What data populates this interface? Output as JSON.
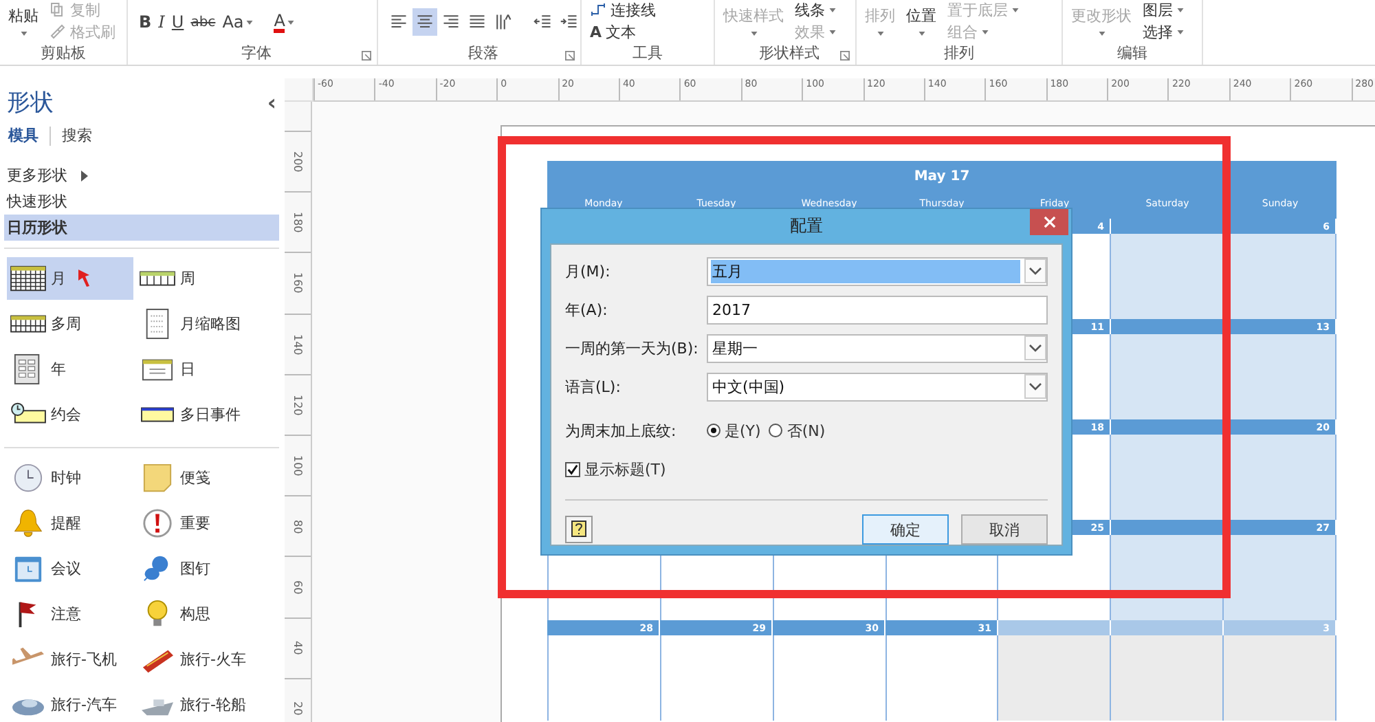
{
  "ribbon": {
    "groups": [
      {
        "label": "剪贴板",
        "launcher": false,
        "stacks": [
          [
            {
              "kind": "large",
              "label": "粘贴",
              "caret": true,
              "disabled": false
            }
          ],
          [
            {
              "kind": "small",
              "label": "复制",
              "caret": false,
              "disabled": true
            },
            {
              "kind": "small",
              "label": "格式刷",
              "caret": false,
              "disabled": true
            }
          ]
        ]
      },
      {
        "label": "字体",
        "launcher": true,
        "stacks": [
          [
            {
              "kind": "toolbar",
              "buttons": [
                {
                  "label": "B",
                  "caret": false,
                  "selected": false
                },
                {
                  "label": "I",
                  "caret": false,
                  "selected": false
                },
                {
                  "label": "U",
                  "caret": false,
                  "selected": false
                },
                {
                  "label": "abc",
                  "caret": false,
                  "selected": false
                },
                {
                  "label": "Aa",
                  "caret": true,
                  "selected": false
                },
                {
                  "label": "A",
                  "caret": true,
                  "selected": false
                }
              ]
            }
          ]
        ]
      },
      {
        "label": "段落",
        "launcher": true,
        "stacks": [
          [
            {
              "kind": "toolbar",
              "buttons": [
                {
                  "selected": false
                },
                {
                  "selected": true
                },
                {
                  "selected": false
                },
                {
                  "selected": false
                },
                {
                  "selected": false
                },
                {
                  "selected": false
                },
                {
                  "selected": false
                }
              ]
            }
          ]
        ]
      },
      {
        "label": "工具",
        "launcher": false,
        "stacks": [
          [
            {
              "kind": "small",
              "label": "连接线",
              "caret": false,
              "disabled": false
            },
            {
              "kind": "small",
              "glyph": "A",
              "label": "文本",
              "caret": false,
              "disabled": false
            }
          ]
        ]
      },
      {
        "label": "形状样式",
        "launcher": true,
        "stacks": [
          [
            {
              "kind": "large",
              "label": "快速样式",
              "caret": true,
              "disabled": true
            }
          ],
          [
            {
              "kind": "small",
              "label": "线条",
              "caret": true,
              "disabled": false
            },
            {
              "kind": "small",
              "label": "效果",
              "caret": true,
              "disabled": true
            }
          ]
        ]
      },
      {
        "label": "排列",
        "launcher": false,
        "stacks": [
          [
            {
              "kind": "large",
              "label": "排列",
              "caret": true,
              "disabled": true
            }
          ],
          [
            {
              "kind": "large",
              "label": "位置",
              "caret": true,
              "disabled": false
            }
          ],
          [
            {
              "kind": "small",
              "label": "置于底层",
              "caret": true,
              "disabled": true
            },
            {
              "kind": "small",
              "label": "组合",
              "caret": true,
              "disabled": true
            }
          ]
        ]
      },
      {
        "label": "编辑",
        "launcher": false,
        "stacks": [
          [
            {
              "kind": "large",
              "label": "更改形状",
              "caret": true,
              "disabled": true
            }
          ],
          [
            {
              "kind": "small",
              "label": "图层",
              "caret": true,
              "disabled": false
            },
            {
              "kind": "small",
              "label": "选择",
              "caret": true,
              "disabled": false
            }
          ]
        ]
      }
    ]
  },
  "sidebar": {
    "title": "形状",
    "collapse": "‹",
    "tabs": [
      {
        "label": "模具",
        "selected": true
      },
      {
        "label": "搜索",
        "selected": false
      }
    ],
    "nav": [
      {
        "label": "更多形状",
        "submenu": true,
        "selected": false
      },
      {
        "label": "快速形状",
        "submenu": false,
        "selected": false
      },
      {
        "label": "日历形状",
        "submenu": false,
        "selected": true
      }
    ],
    "shape_groups": [
      [
        {
          "label": "月",
          "selected": true
        },
        {
          "label": "周",
          "selected": false
        },
        {
          "label": "多周",
          "selected": false
        },
        {
          "label": "月缩略图",
          "selected": false
        },
        {
          "label": "年",
          "selected": false
        },
        {
          "label": "日",
          "selected": false
        },
        {
          "label": "约会",
          "selected": false
        },
        {
          "label": "多日事件",
          "selected": false
        }
      ],
      [
        {
          "label": "时钟",
          "selected": false
        },
        {
          "label": "便笺",
          "selected": false
        },
        {
          "label": "提醒",
          "selected": false
        },
        {
          "label": "重要",
          "selected": false
        },
        {
          "label": "会议",
          "selected": false
        },
        {
          "label": "图钉",
          "selected": false
        },
        {
          "label": "注意",
          "selected": false
        },
        {
          "label": "构思",
          "selected": false
        },
        {
          "label": "旅行-飞机",
          "selected": false
        },
        {
          "label": "旅行-火车",
          "selected": false
        },
        {
          "label": "旅行-汽车",
          "selected": false
        },
        {
          "label": "旅行-轮船",
          "selected": false
        }
      ]
    ]
  },
  "rulers": {
    "horizontal": [
      "-60",
      "-40",
      "-20",
      "0",
      "20",
      "40",
      "60",
      "80",
      "100",
      "120",
      "140",
      "160",
      "180",
      "200",
      "220",
      "240",
      "260",
      "280"
    ],
    "vertical": [
      "200",
      "180",
      "160",
      "140",
      "120",
      "100",
      "80",
      "60",
      "40",
      "20"
    ]
  },
  "calendar": {
    "title": "May 17",
    "weekend_shaded": true,
    "days": [
      "Monday",
      "Tuesday",
      "Wednesday",
      "Thursday",
      "Friday",
      "Saturday",
      "Sunday"
    ],
    "weeks": [
      {
        "cells": [
          {},
          {},
          {},
          {},
          {
            "date": "4",
            "other_month": false
          },
          {
            "other_month": false
          },
          {
            "date": "6",
            "other_month": false
          }
        ]
      },
      {
        "cells": [
          {},
          {},
          {},
          {},
          {
            "date": "11",
            "other_month": false
          },
          {
            "other_month": false
          },
          {
            "date": "13",
            "other_month": false
          }
        ]
      },
      {
        "cells": [
          {},
          {},
          {},
          {},
          {
            "date": "18",
            "other_month": false
          },
          {
            "other_month": false
          },
          {
            "date": "20",
            "other_month": false
          }
        ]
      },
      {
        "cells": [
          {
            "other_month": false
          },
          {
            "other_month": false
          },
          {
            "other_month": false
          },
          {
            "other_month": false
          },
          {
            "date": "25",
            "other_month": false
          },
          {
            "other_month": false
          },
          {
            "date": "27",
            "other_month": false
          }
        ]
      },
      {
        "cells": [
          {
            "date": "28",
            "other_month": false
          },
          {
            "date": "29",
            "other_month": false
          },
          {
            "date": "30",
            "other_month": false
          },
          {
            "date": "31",
            "other_month": false
          },
          {
            "other_month": true
          },
          {
            "other_month": true
          },
          {
            "date": "3",
            "other_month": true
          }
        ]
      }
    ]
  },
  "dialog": {
    "title": "配置",
    "fields": [
      {
        "label": "月(M):",
        "kind": "dropdown",
        "value": "五月",
        "highlighted": true
      },
      {
        "label": "年(A):",
        "kind": "text",
        "value": "2017",
        "highlighted": false
      },
      {
        "label": "一周的第一天为(B):",
        "kind": "dropdown",
        "value": "星期一",
        "highlighted": false
      },
      {
        "label": "语言(L):",
        "kind": "dropdown",
        "value": "中文(中国)",
        "highlighted": false
      }
    ],
    "weekend_shading": {
      "label": "为周末加上底纹:",
      "options": [
        {
          "label": "是(Y)",
          "selected": true
        },
        {
          "label": "否(N)",
          "selected": false
        }
      ]
    },
    "show_title": {
      "label": "显示标题(T)",
      "checked": true
    },
    "buttons": [
      {
        "label": "确定",
        "default": true
      },
      {
        "label": "取消",
        "default": false
      }
    ]
  }
}
